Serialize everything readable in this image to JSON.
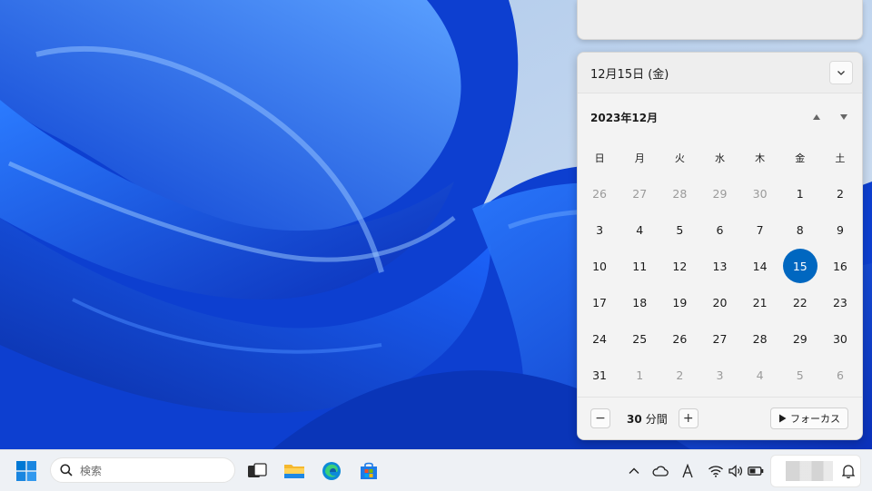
{
  "calendar": {
    "header_date": "12月15日 (金)",
    "month_title": "2023年12月",
    "weekdays": [
      "日",
      "月",
      "火",
      "水",
      "木",
      "金",
      "土"
    ],
    "weeks": [
      [
        "26",
        "27",
        "28",
        "29",
        "30",
        "1",
        "2"
      ],
      [
        "3",
        "4",
        "5",
        "6",
        "7",
        "8",
        "9"
      ],
      [
        "10",
        "11",
        "12",
        "13",
        "14",
        "15",
        "16"
      ],
      [
        "17",
        "18",
        "19",
        "20",
        "21",
        "22",
        "23"
      ],
      [
        "24",
        "25",
        "26",
        "27",
        "28",
        "29",
        "30"
      ],
      [
        "31",
        "1",
        "2",
        "3",
        "4",
        "5",
        "6"
      ]
    ],
    "today": "15",
    "focus": {
      "minus": "−",
      "minutes": "30",
      "unit": "分間",
      "plus": "+",
      "start_label": "フォーカス"
    }
  },
  "taskbar": {
    "search_placeholder": "検索",
    "apps": [
      "task-view",
      "file-explorer",
      "edge",
      "microsoft-store"
    ],
    "tray": [
      "chevron-up-icon",
      "cloud-icon",
      "ime-a-icon",
      "wifi-icon",
      "speaker-icon",
      "battery-icon",
      "bell-icon"
    ]
  },
  "colors": {
    "accent": "#0067c0",
    "wallpaper_deep": "#0a3fd6",
    "wallpaper_light": "#7fb2ff",
    "wallpaper_bg": "#c9dbef"
  }
}
